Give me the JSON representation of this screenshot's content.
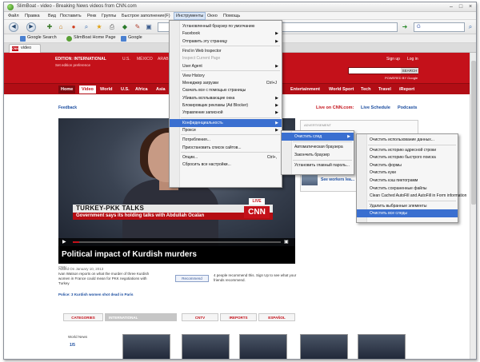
{
  "window": {
    "title": "SlimBoat - video - Breaking News videos from CNN.com",
    "min": "–",
    "max": "□",
    "close": "×"
  },
  "menubar": [
    "Файл",
    "Правка",
    "Вид",
    "Поставить",
    "Рекк",
    "Группы",
    "Быстрое заполнение(F)",
    "Инструменты",
    "Окно",
    "Помощь"
  ],
  "navbar": {
    "back_icon": "back-arrow-icon",
    "forward_icon": "forward-arrow-icon",
    "search_engine": "Google"
  },
  "bookmarks": [
    {
      "label": "Google Search",
      "icon": "google-icon"
    },
    {
      "label": "SlimBoat Home Page",
      "icon": "slimboat-icon"
    },
    {
      "label": "Google",
      "icon": "google-icon"
    }
  ],
  "tabs": [
    {
      "label": "video",
      "icon": "cnn-icon"
    }
  ],
  "cnn": {
    "edition": "EDITION: INTERNATIONAL",
    "editions": [
      "U.S.",
      "MÉXICO",
      "ARABIC"
    ],
    "set_pref": "Set edition preference",
    "sign_up": "Sign up",
    "log_in": "Log in",
    "search_btn": "SEARCH",
    "powered": "POWERED BY Google",
    "nav": [
      "Home",
      "Video",
      "World",
      "U.S.",
      "Africa",
      "Asia",
      "Entertainment",
      "World Sport",
      "Tech",
      "Travel",
      "iReport"
    ],
    "feedback": "Feedback",
    "live_on": "Live on CNN.com:",
    "live_schedule": "Live Schedule",
    "podcasts": "Podcasts",
    "ticker_top": "TURKEY-PKK TALKS",
    "ticker_bottom": "Government says its holding talks with Abdullah Ocalan",
    "live_badge": "LIVE",
    "logo": "CNN",
    "video_title": "Political impact of Kurdish murders",
    "source": "CNN",
    "added": "Added On January 10, 2013",
    "description": "Ivan Watson reports on what the murder of three Kurdish women in France could mean for PKK negotiations with Turkey",
    "related": "Police: 3 Kurdish women shot dead in Paris",
    "recommend_btn": "Recommend",
    "recommend_text": "4 people recommend this. Sign Up to see what your friends recommend.",
    "categories": [
      "CATEGORIES",
      "INTERNATIONAL",
      "CNTV",
      "IREPORTS",
      "ESPAÑOL"
    ],
    "world_news": "World News",
    "more_label": "1/5",
    "ad_label": "ADVERTISEMENT",
    "see_workers": "See workers lea...",
    "progress": 0.03
  },
  "tools_menu": [
    {
      "label": "Установленный браузер по умолчанию",
      "hl": false,
      "dis": false
    },
    {
      "label": "Facebook",
      "arrow": true
    },
    {
      "label": "Отправить эту страницу",
      "arrow": true
    },
    {
      "sep": true
    },
    {
      "label": "Find in Web Inspector"
    },
    {
      "label": "Inspect Current Page",
      "dis": true
    },
    {
      "label": "User Agent",
      "arrow": true
    },
    {
      "sep": true
    },
    {
      "label": "View History"
    },
    {
      "label": "Менеджер загрузки",
      "sc": "Ctrl+J"
    },
    {
      "label": "Скачать все с помощью страницы"
    },
    {
      "label": "Убивать всплывающие окна",
      "arrow": true
    },
    {
      "label": "Блокировщик рекламы (Ad Blocker)",
      "arrow": true
    },
    {
      "label": "Управление записной",
      "arrow": true
    },
    {
      "sep": true
    },
    {
      "label": "Конфиденциальность",
      "arrow": true,
      "hl": true
    },
    {
      "label": "Прокси",
      "arrow": true
    },
    {
      "sep": true
    },
    {
      "label": "Потребления..."
    },
    {
      "label": "Приостановить список сайтов..."
    },
    {
      "sep": true
    },
    {
      "label": "Опции...",
      "sc": "Ctrl+,"
    },
    {
      "label": "Сбросить все настройки..."
    }
  ],
  "privacy_menu": [
    {
      "label": "Очистить след",
      "arrow": true,
      "hl": true
    },
    {
      "sep": true
    },
    {
      "label": "Автоматическая браузера"
    },
    {
      "label": "Закончить браузер"
    },
    {
      "sep": true
    },
    {
      "label": "Установить главный пароль..."
    }
  ],
  "clear_menu": [
    {
      "label": "Очистить использование данных..."
    },
    {
      "sep": true
    },
    {
      "label": "Очистить историю адресной строки"
    },
    {
      "label": "Очистить историю быстрого поиска"
    },
    {
      "label": "Очистить формы"
    },
    {
      "label": "Очистить куки"
    },
    {
      "label": "Очистить кэш пиктограмм"
    },
    {
      "label": "Очистить сохраненные файлы"
    },
    {
      "label": "Clean Cached AutoFill and AutoFill in Form information"
    },
    {
      "sep": true
    },
    {
      "label": "Удалить выбранные элементы"
    },
    {
      "label": "Очистить все следы",
      "hl": true
    }
  ]
}
